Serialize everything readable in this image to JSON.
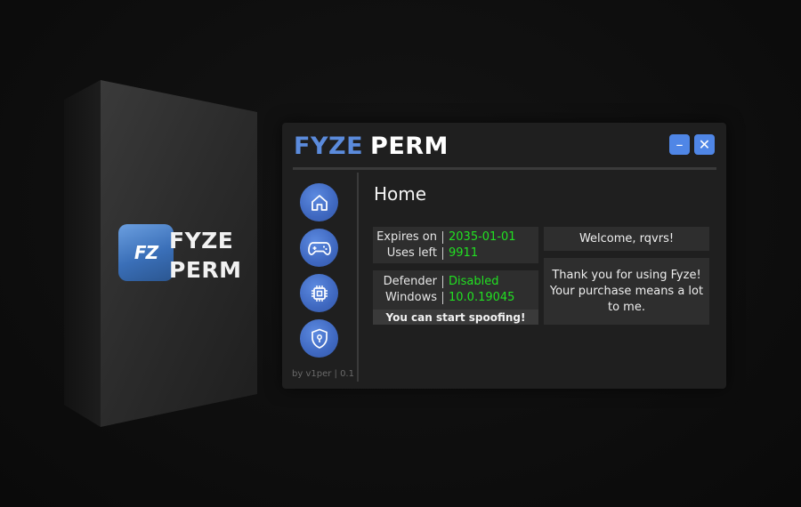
{
  "box": {
    "logo_text": "FZ",
    "title_line1": "FYZE",
    "title_line2": "PERM"
  },
  "window": {
    "title_part1": "FYZE",
    "title_part2": "PERM",
    "minimize_label": "–",
    "close_label": "✕",
    "page_title": "Home",
    "footer": "by v1per | 0.1"
  },
  "nav": [
    {
      "icon": "home-icon"
    },
    {
      "icon": "gamepad-icon"
    },
    {
      "icon": "cpu-chip-icon"
    },
    {
      "icon": "shield-lock-icon"
    }
  ],
  "license": {
    "expires_label": "Expires on",
    "expires_value": "2035-01-01",
    "uses_label": "Uses left",
    "uses_value": "9911"
  },
  "system": {
    "defender_label": "Defender",
    "defender_value": "Disabled",
    "windows_label": "Windows",
    "windows_value": "10.0.19045",
    "status": "You can start spoofing!"
  },
  "welcome": "Welcome, rqvrs!",
  "thanks": "Thank you for using Fyze! Your purchase means a lot to me.",
  "colors": {
    "accent": "#5b8bdc",
    "button": "#4f86e6",
    "value_green": "#22e022",
    "window_bg": "#1f1f1f",
    "panel_bg": "#2e2e2e"
  }
}
